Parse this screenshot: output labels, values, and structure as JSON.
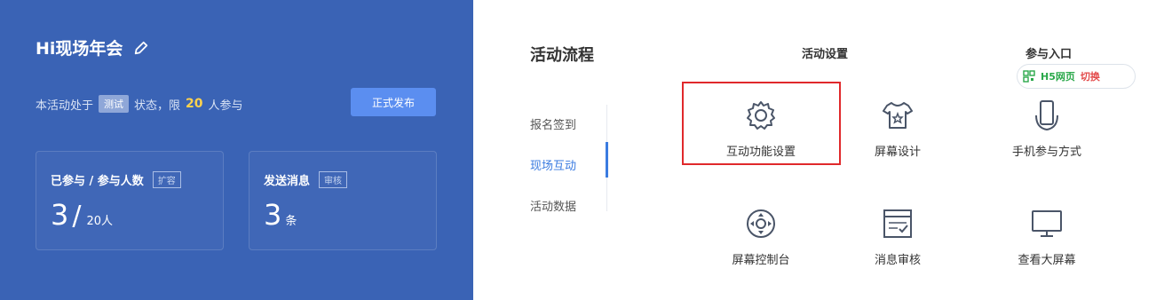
{
  "left": {
    "title": "Hi现场年会",
    "status_prefix": "本活动处于",
    "status_tag": "测试",
    "status_mid": "状态，限",
    "status_num": "20",
    "status_suffix": "人参与",
    "publish_label": "正式发布",
    "card1": {
      "label": "已参与 / 参与人数",
      "tag": "扩容",
      "value": "3",
      "limit": "20人"
    },
    "card2": {
      "label": "发送消息",
      "tag": "审核",
      "value": "3",
      "unit": "条"
    }
  },
  "right": {
    "section_title": "活动流程",
    "col_settings": "活动设置",
    "col_entry": "参与入口",
    "nav": [
      "报名签到",
      "现场互动",
      "活动数据"
    ],
    "tiles": {
      "interactive": "互动功能设置",
      "screen_design": "屏幕设计",
      "mobile": "手机参与方式",
      "screen_console": "屏幕控制台",
      "msg_review": "消息审核",
      "big_screen": "查看大屏幕"
    },
    "entry_tag": {
      "label": "H5网页",
      "switch": "切换"
    }
  },
  "colors": {
    "panel_blue": "#3a63b5",
    "accent_blue": "#3a7be0",
    "highlight_red": "#e0292b"
  }
}
